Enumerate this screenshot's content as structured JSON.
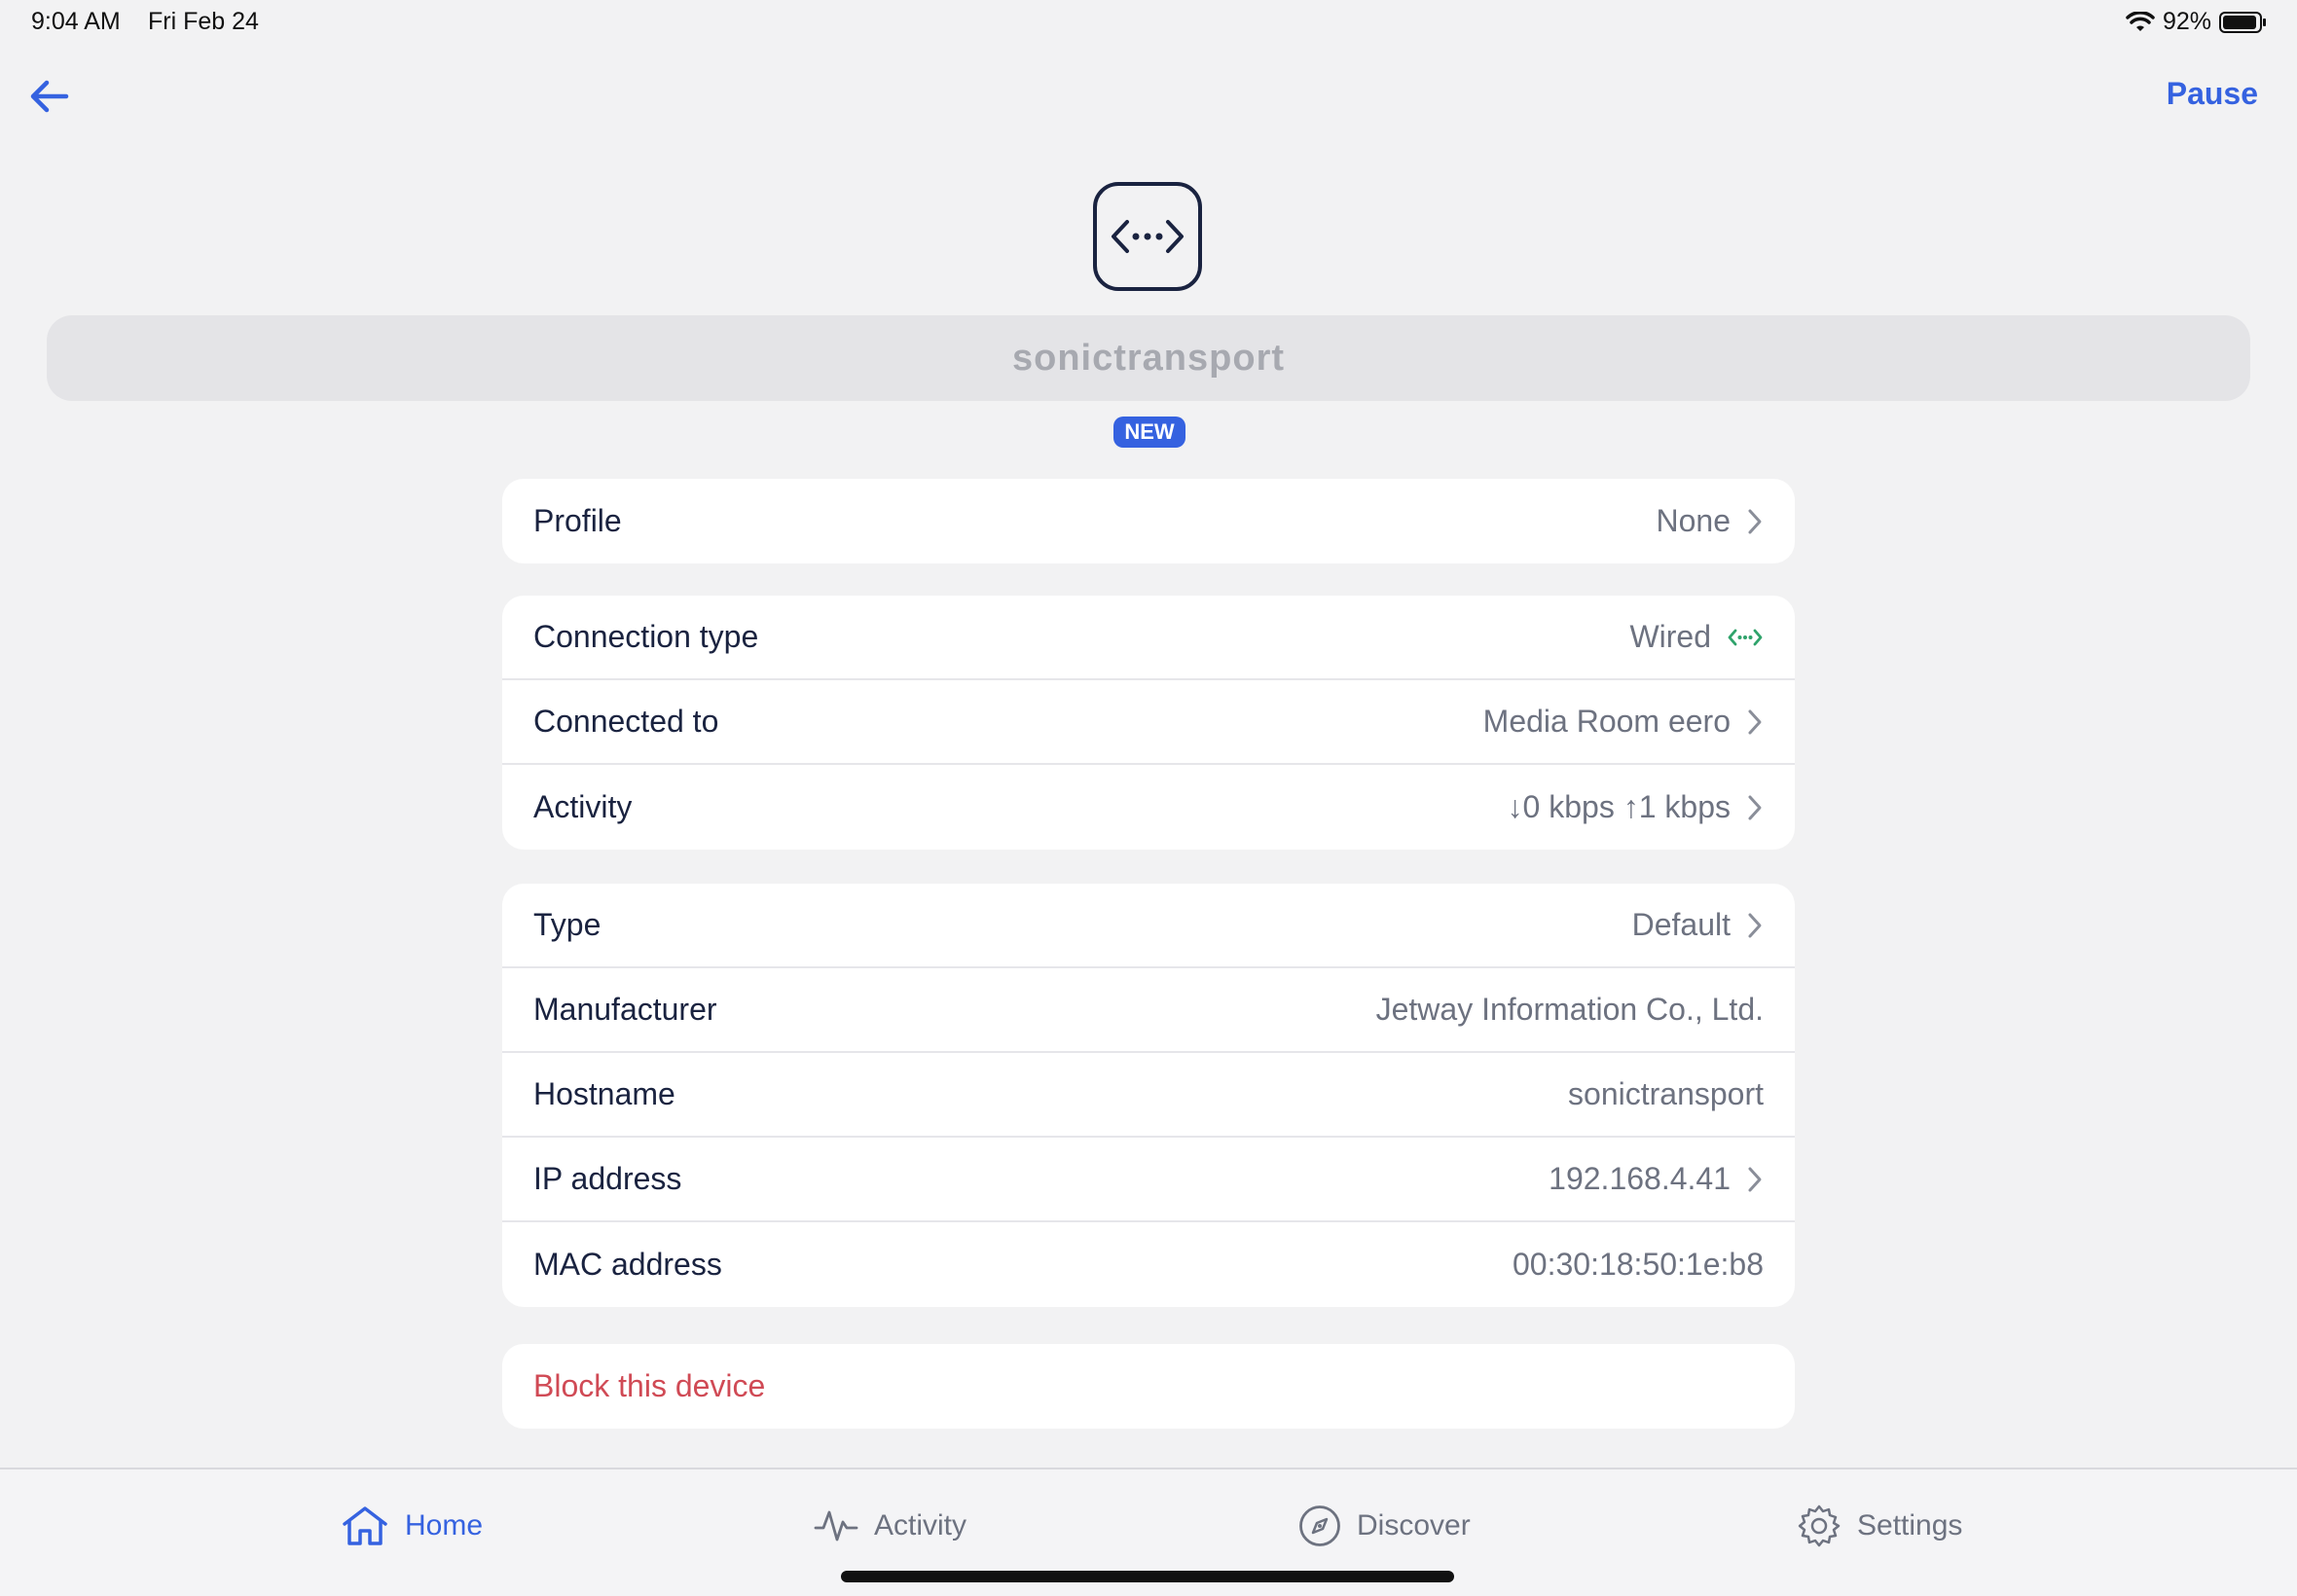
{
  "status_bar": {
    "time": "9:04 AM",
    "date": "Fri Feb 24",
    "battery": "92%"
  },
  "nav": {
    "back_icon": "arrow-left-icon",
    "pause_label": "Pause"
  },
  "device": {
    "icon": "wired-connection-icon",
    "name": "sonictransport",
    "badge": "NEW"
  },
  "sections": {
    "profile": {
      "label": "Profile",
      "value": "None"
    },
    "connection": [
      {
        "label": "Connection type",
        "value": "Wired"
      },
      {
        "label": "Connected to",
        "value": "Media Room eero"
      },
      {
        "label": "Activity",
        "value": "↓0 kbps ↑1 kbps"
      }
    ],
    "details": [
      {
        "label": "Type",
        "value": "Default"
      },
      {
        "label": "Manufacturer",
        "value": "Jetway Information Co., Ltd."
      },
      {
        "label": "Hostname",
        "value": "sonictransport"
      },
      {
        "label": "IP address",
        "value": "192.168.4.41"
      },
      {
        "label": "MAC address",
        "value": "00:30:18:50:1e:b8"
      }
    ],
    "block_label": "Block this device"
  },
  "tabs": [
    {
      "label": "Home",
      "icon": "home-icon",
      "active": true
    },
    {
      "label": "Activity",
      "icon": "activity-pulse-icon"
    },
    {
      "label": "Discover",
      "icon": "compass-icon"
    },
    {
      "label": "Settings",
      "icon": "gear-icon"
    }
  ],
  "colors": {
    "accent": "#3562e0",
    "danger": "#d04a55",
    "wired_green": "#2fa36b"
  }
}
